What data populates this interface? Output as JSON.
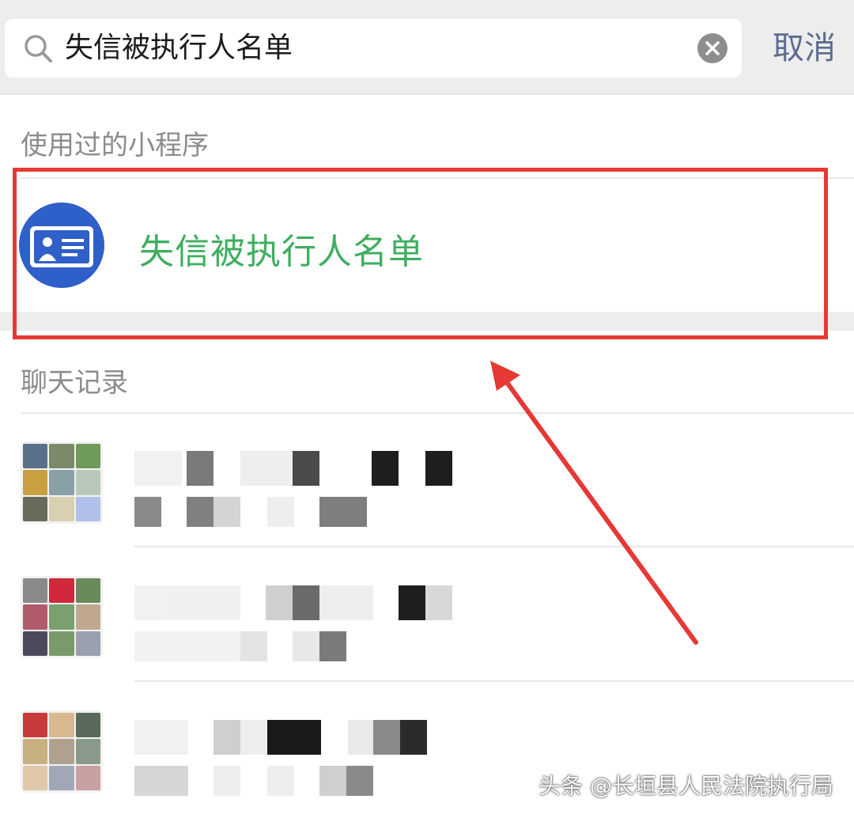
{
  "search": {
    "query": "失信被执行人名单",
    "cancel_label": "取消"
  },
  "sections": {
    "mini_programs": "使用过的小程序",
    "chat_history": "聊天记录"
  },
  "mini_program": {
    "name": "失信被执行人名单",
    "icon": "id-card-icon"
  },
  "colors": {
    "accent_green": "#3fae5f",
    "highlight_red": "#e53935",
    "link_blue": "#5c6c8e"
  },
  "chat_results": [
    {
      "avatar": "group-avatar"
    },
    {
      "avatar": "group-avatar"
    },
    {
      "avatar": "group-avatar"
    }
  ],
  "watermark": "头条 @长垣县人民法院执行局"
}
